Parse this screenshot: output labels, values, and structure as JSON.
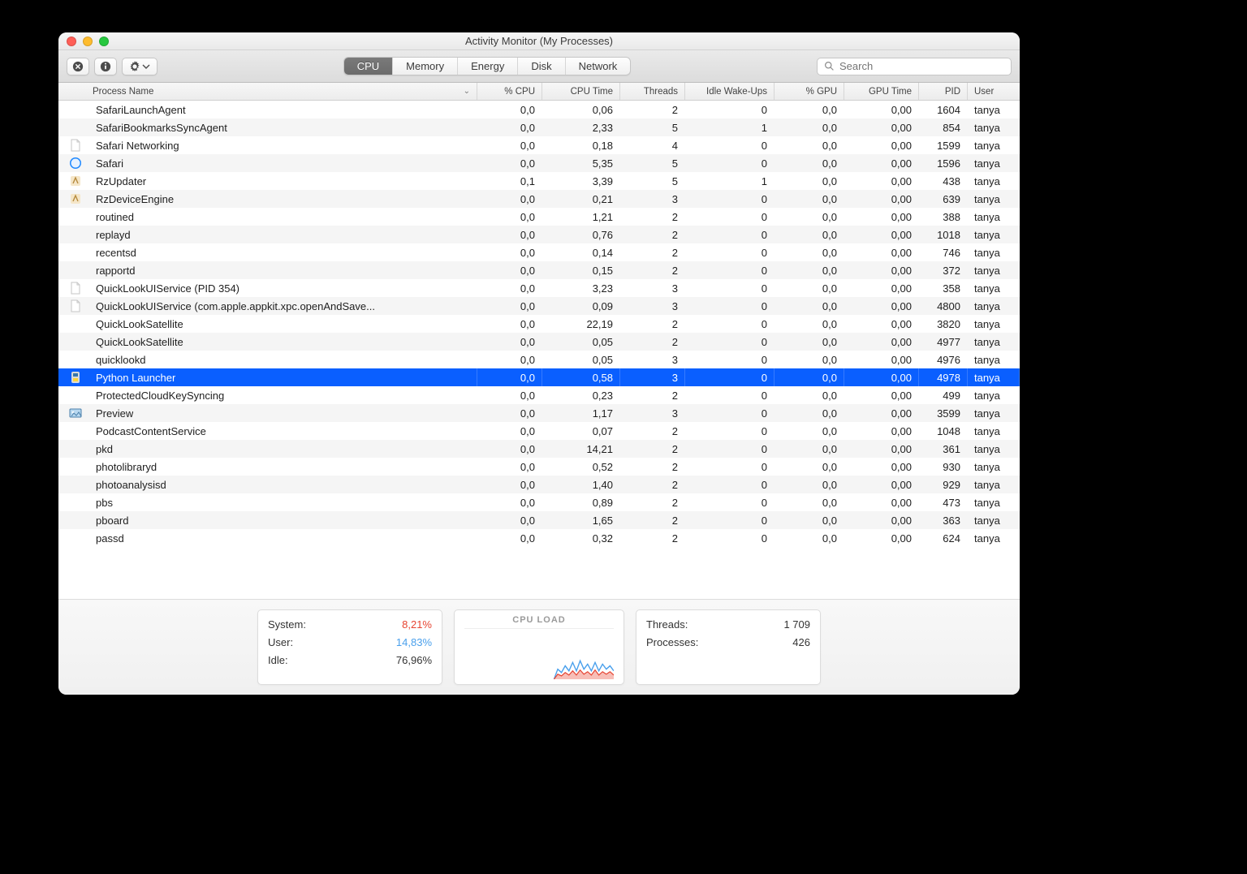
{
  "window": {
    "title": "Activity Monitor (My Processes)"
  },
  "toolbar": {
    "tabs": {
      "cpu": "CPU",
      "memory": "Memory",
      "energy": "Energy",
      "disk": "Disk",
      "network": "Network",
      "active": "cpu"
    },
    "search_placeholder": "Search"
  },
  "columns": {
    "name": "Process Name",
    "cpu": "% CPU",
    "time": "CPU Time",
    "threads": "Threads",
    "idle": "Idle Wake-Ups",
    "gpu": "% GPU",
    "gtime": "GPU Time",
    "pid": "PID",
    "user": "User"
  },
  "processes": [
    {
      "icon": "",
      "name": "SafariLaunchAgent",
      "cpu": "0,0",
      "time": "0,06",
      "thr": "2",
      "idle": "0",
      "gpu": "0,0",
      "gtime": "0,00",
      "pid": "1604",
      "user": "tanya"
    },
    {
      "icon": "",
      "name": "SafariBookmarksSyncAgent",
      "cpu": "0,0",
      "time": "2,33",
      "thr": "5",
      "idle": "1",
      "gpu": "0,0",
      "gtime": "0,00",
      "pid": "854",
      "user": "tanya"
    },
    {
      "icon": "doc",
      "name": "Safari Networking",
      "cpu": "0,0",
      "time": "0,18",
      "thr": "4",
      "idle": "0",
      "gpu": "0,0",
      "gtime": "0,00",
      "pid": "1599",
      "user": "tanya"
    },
    {
      "icon": "safari",
      "name": "Safari",
      "cpu": "0,0",
      "time": "5,35",
      "thr": "5",
      "idle": "0",
      "gpu": "0,0",
      "gtime": "0,00",
      "pid": "1596",
      "user": "tanya"
    },
    {
      "icon": "rz",
      "name": "RzUpdater",
      "cpu": "0,1",
      "time": "3,39",
      "thr": "5",
      "idle": "1",
      "gpu": "0,0",
      "gtime": "0,00",
      "pid": "438",
      "user": "tanya"
    },
    {
      "icon": "rz",
      "name": "RzDeviceEngine",
      "cpu": "0,0",
      "time": "0,21",
      "thr": "3",
      "idle": "0",
      "gpu": "0,0",
      "gtime": "0,00",
      "pid": "639",
      "user": "tanya"
    },
    {
      "icon": "",
      "name": "routined",
      "cpu": "0,0",
      "time": "1,21",
      "thr": "2",
      "idle": "0",
      "gpu": "0,0",
      "gtime": "0,00",
      "pid": "388",
      "user": "tanya"
    },
    {
      "icon": "",
      "name": "replayd",
      "cpu": "0,0",
      "time": "0,76",
      "thr": "2",
      "idle": "0",
      "gpu": "0,0",
      "gtime": "0,00",
      "pid": "1018",
      "user": "tanya"
    },
    {
      "icon": "",
      "name": "recentsd",
      "cpu": "0,0",
      "time": "0,14",
      "thr": "2",
      "idle": "0",
      "gpu": "0,0",
      "gtime": "0,00",
      "pid": "746",
      "user": "tanya"
    },
    {
      "icon": "",
      "name": "rapportd",
      "cpu": "0,0",
      "time": "0,15",
      "thr": "2",
      "idle": "0",
      "gpu": "0,0",
      "gtime": "0,00",
      "pid": "372",
      "user": "tanya"
    },
    {
      "icon": "doc",
      "name": "QuickLookUIService (PID 354)",
      "cpu": "0,0",
      "time": "3,23",
      "thr": "3",
      "idle": "0",
      "gpu": "0,0",
      "gtime": "0,00",
      "pid": "358",
      "user": "tanya"
    },
    {
      "icon": "doc",
      "name": "QuickLookUIService (com.apple.appkit.xpc.openAndSave...",
      "cpu": "0,0",
      "time": "0,09",
      "thr": "3",
      "idle": "0",
      "gpu": "0,0",
      "gtime": "0,00",
      "pid": "4800",
      "user": "tanya"
    },
    {
      "icon": "",
      "name": "QuickLookSatellite",
      "cpu": "0,0",
      "time": "22,19",
      "thr": "2",
      "idle": "0",
      "gpu": "0,0",
      "gtime": "0,00",
      "pid": "3820",
      "user": "tanya"
    },
    {
      "icon": "",
      "name": "QuickLookSatellite",
      "cpu": "0,0",
      "time": "0,05",
      "thr": "2",
      "idle": "0",
      "gpu": "0,0",
      "gtime": "0,00",
      "pid": "4977",
      "user": "tanya"
    },
    {
      "icon": "",
      "name": "quicklookd",
      "cpu": "0,0",
      "time": "0,05",
      "thr": "3",
      "idle": "0",
      "gpu": "0,0",
      "gtime": "0,00",
      "pid": "4976",
      "user": "tanya"
    },
    {
      "icon": "python",
      "name": "Python Launcher",
      "cpu": "0,0",
      "time": "0,58",
      "thr": "3",
      "idle": "0",
      "gpu": "0,0",
      "gtime": "0,00",
      "pid": "4978",
      "user": "tanya",
      "selected": true
    },
    {
      "icon": "",
      "name": "ProtectedCloudKeySyncing",
      "cpu": "0,0",
      "time": "0,23",
      "thr": "2",
      "idle": "0",
      "gpu": "0,0",
      "gtime": "0,00",
      "pid": "499",
      "user": "tanya"
    },
    {
      "icon": "preview",
      "name": "Preview",
      "cpu": "0,0",
      "time": "1,17",
      "thr": "3",
      "idle": "0",
      "gpu": "0,0",
      "gtime": "0,00",
      "pid": "3599",
      "user": "tanya"
    },
    {
      "icon": "",
      "name": "PodcastContentService",
      "cpu": "0,0",
      "time": "0,07",
      "thr": "2",
      "idle": "0",
      "gpu": "0,0",
      "gtime": "0,00",
      "pid": "1048",
      "user": "tanya"
    },
    {
      "icon": "",
      "name": "pkd",
      "cpu": "0,0",
      "time": "14,21",
      "thr": "2",
      "idle": "0",
      "gpu": "0,0",
      "gtime": "0,00",
      "pid": "361",
      "user": "tanya"
    },
    {
      "icon": "",
      "name": "photolibraryd",
      "cpu": "0,0",
      "time": "0,52",
      "thr": "2",
      "idle": "0",
      "gpu": "0,0",
      "gtime": "0,00",
      "pid": "930",
      "user": "tanya"
    },
    {
      "icon": "",
      "name": "photoanalysisd",
      "cpu": "0,0",
      "time": "1,40",
      "thr": "2",
      "idle": "0",
      "gpu": "0,0",
      "gtime": "0,00",
      "pid": "929",
      "user": "tanya"
    },
    {
      "icon": "",
      "name": "pbs",
      "cpu": "0,0",
      "time": "0,89",
      "thr": "2",
      "idle": "0",
      "gpu": "0,0",
      "gtime": "0,00",
      "pid": "473",
      "user": "tanya"
    },
    {
      "icon": "",
      "name": "pboard",
      "cpu": "0,0",
      "time": "1,65",
      "thr": "2",
      "idle": "0",
      "gpu": "0,0",
      "gtime": "0,00",
      "pid": "363",
      "user": "tanya"
    },
    {
      "icon": "",
      "name": "passd",
      "cpu": "0,0",
      "time": "0,32",
      "thr": "2",
      "idle": "0",
      "gpu": "0,0",
      "gtime": "0,00",
      "pid": "624",
      "user": "tanya"
    }
  ],
  "footer": {
    "system_label": "System:",
    "system_val": "8,21%",
    "user_label": "User:",
    "user_val": "14,83%",
    "idle_label": "Idle:",
    "idle_val": "76,96%",
    "load_title": "CPU LOAD",
    "threads_label": "Threads:",
    "threads_val": "1 709",
    "proc_label": "Processes:",
    "proc_val": "426"
  }
}
